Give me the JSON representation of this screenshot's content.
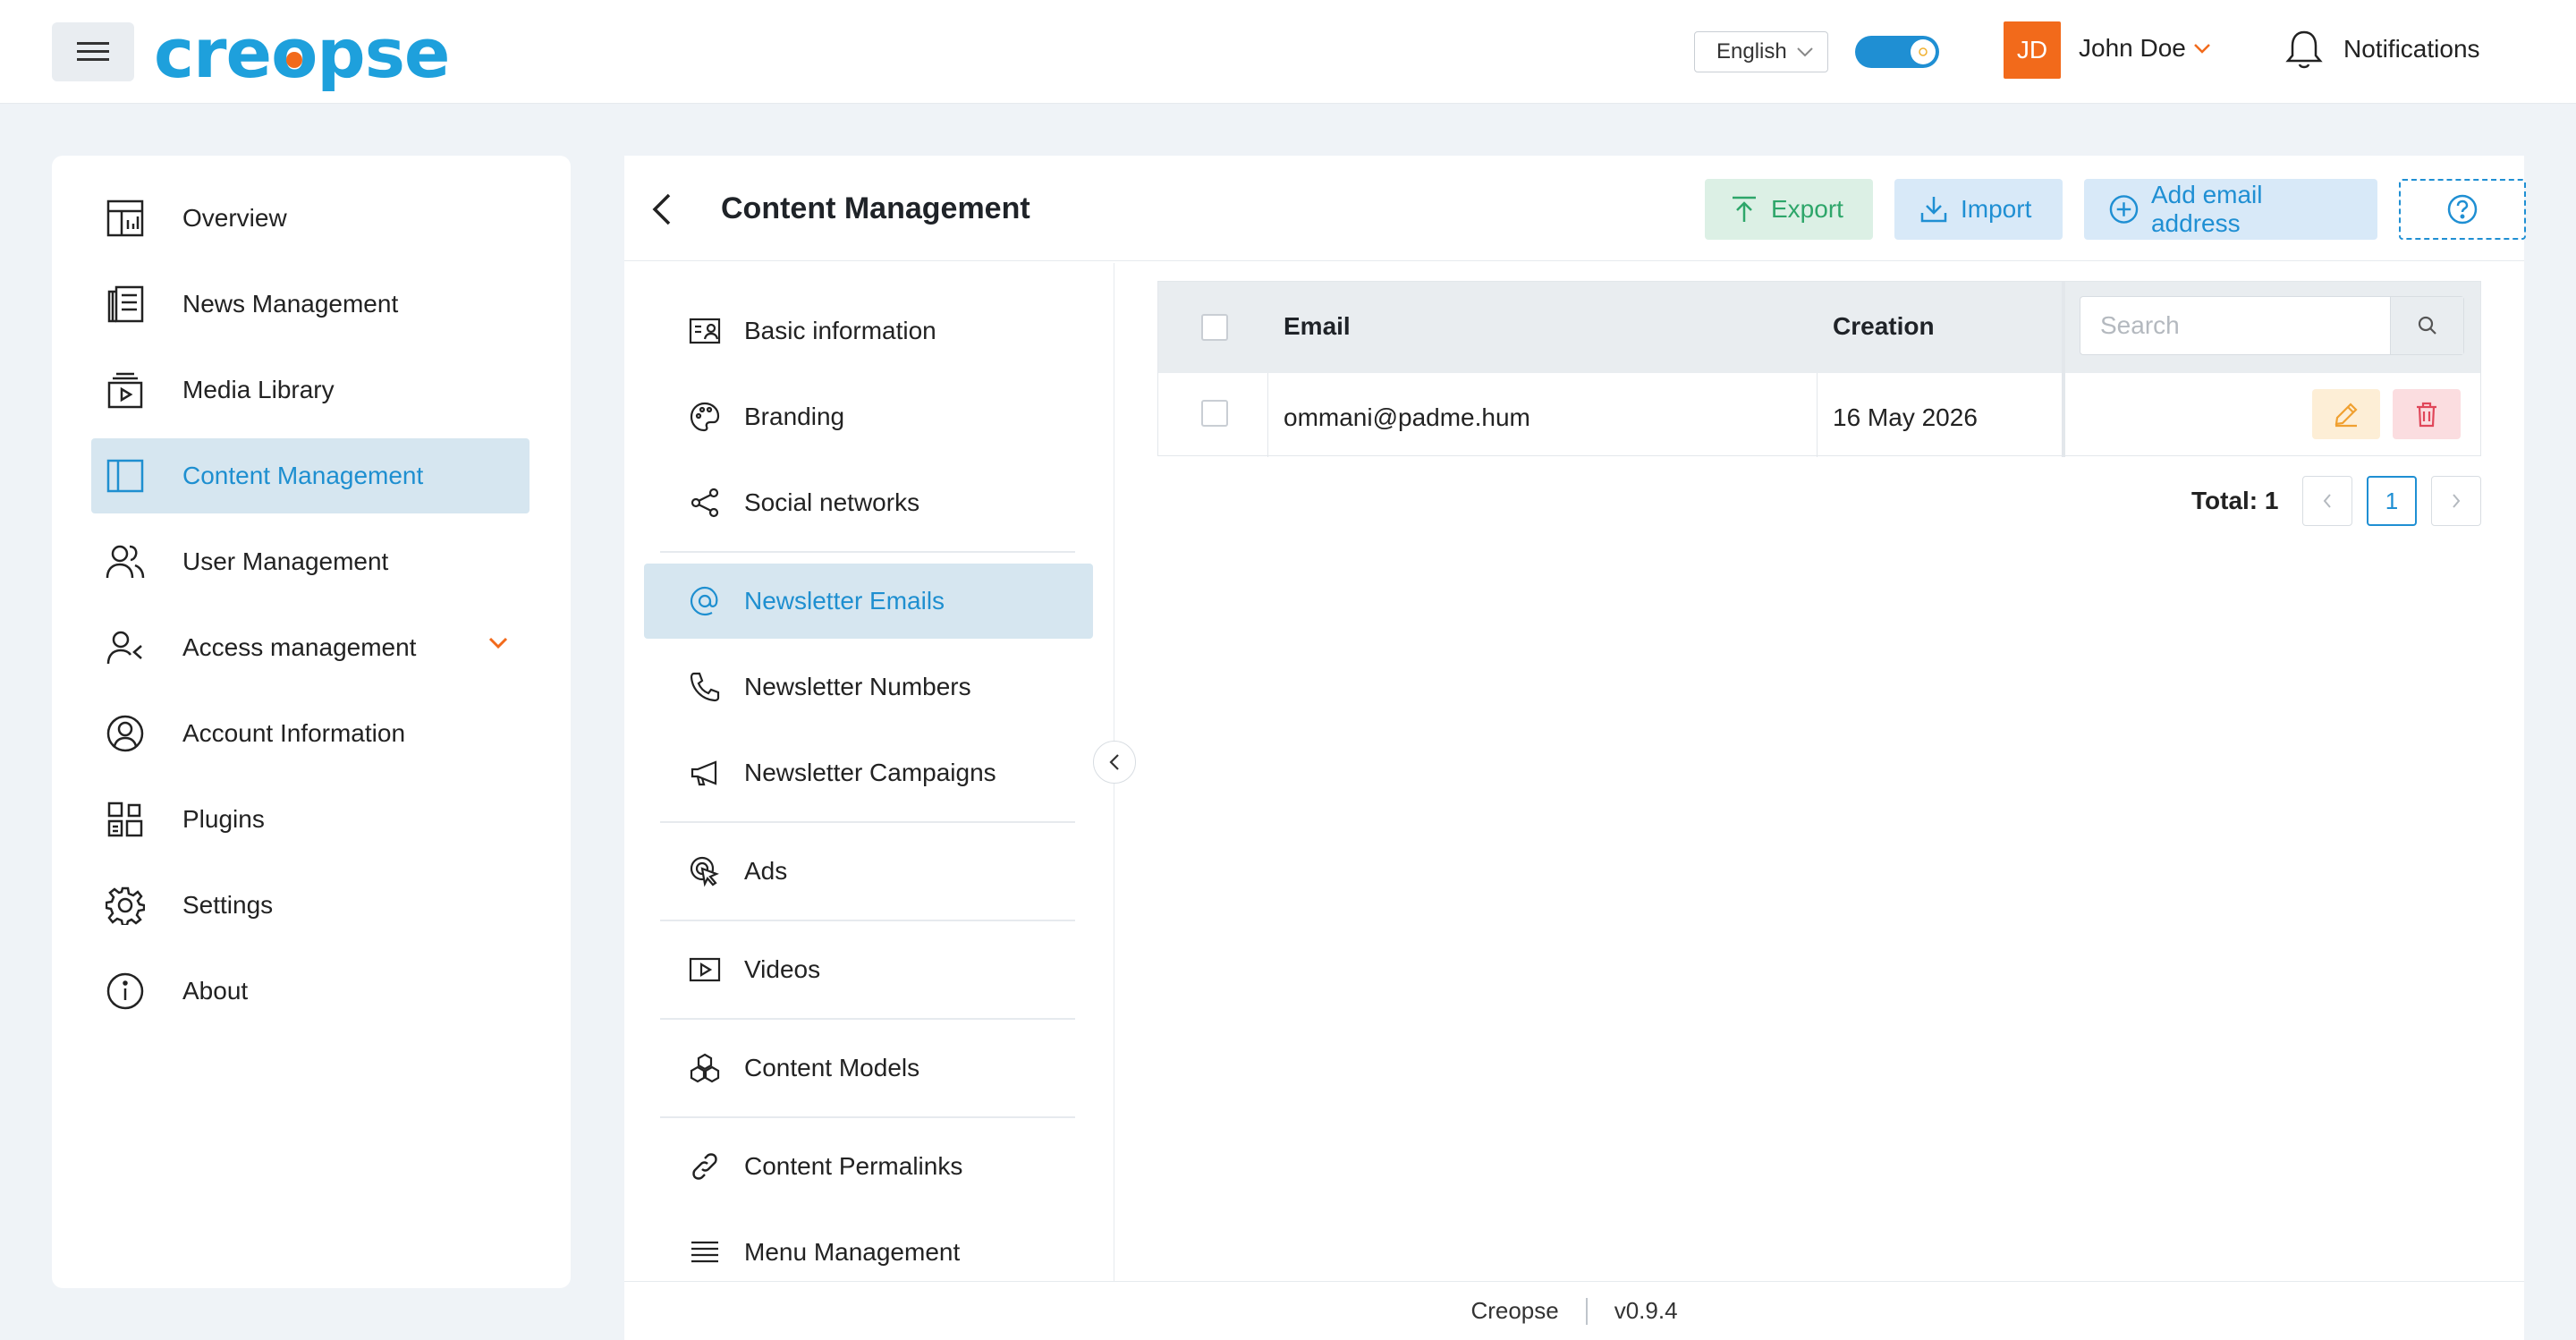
{
  "header": {
    "brand": "creopse",
    "language": "English",
    "user_initials": "JD",
    "user_name": "John Doe",
    "notifications_label": "Notifications"
  },
  "sidebar": {
    "items": [
      {
        "label": "Overview",
        "icon": "dashboard-icon"
      },
      {
        "label": "News Management",
        "icon": "newspaper-icon"
      },
      {
        "label": "Media Library",
        "icon": "media-library-icon"
      },
      {
        "label": "Content Management",
        "icon": "layout-sidebar-icon",
        "active": true
      },
      {
        "label": "User Management",
        "icon": "users-icon"
      },
      {
        "label": "Access management",
        "icon": "user-access-icon",
        "expandable": true
      },
      {
        "label": "Account Information",
        "icon": "user-circle-icon"
      },
      {
        "label": "Plugins",
        "icon": "plugins-icon"
      },
      {
        "label": "Settings",
        "icon": "gear-icon"
      },
      {
        "label": "About",
        "icon": "info-icon"
      }
    ]
  },
  "page": {
    "title": "Content Management",
    "export_label": "Export",
    "import_label": "Import",
    "add_label": "Add email address"
  },
  "subnav": {
    "items": [
      {
        "label": "Basic information",
        "icon": "id-card-icon"
      },
      {
        "label": "Branding",
        "icon": "palette-icon"
      },
      {
        "label": "Social networks",
        "icon": "share-icon"
      },
      {
        "label": "Newsletter Emails",
        "icon": "at-sign-icon",
        "active": true
      },
      {
        "label": "Newsletter Numbers",
        "icon": "phone-icon"
      },
      {
        "label": "Newsletter Campaigns",
        "icon": "megaphone-icon"
      },
      {
        "label": "Ads",
        "icon": "cursor-click-icon"
      },
      {
        "label": "Videos",
        "icon": "video-icon"
      },
      {
        "label": "Content Models",
        "icon": "cubes-icon"
      },
      {
        "label": "Content Permalinks",
        "icon": "link-icon"
      },
      {
        "label": "Menu Management",
        "icon": "menu-lines-icon"
      }
    ]
  },
  "table": {
    "columns": {
      "email": "Email",
      "creation": "Creation"
    },
    "search_placeholder": "Search",
    "rows": [
      {
        "email": "ommani@padme.hum",
        "creation": "16 May 2026"
      }
    ],
    "total_label": "Total: 1",
    "current_page": "1"
  },
  "footer": {
    "app": "Creopse",
    "version": "v0.9.4"
  },
  "colors": {
    "accent": "#1f8fd3",
    "brand_orange": "#f26a1b",
    "export_green": "#2ea66a",
    "delete_red": "#e0475a",
    "edit_orange": "#f0a030"
  }
}
